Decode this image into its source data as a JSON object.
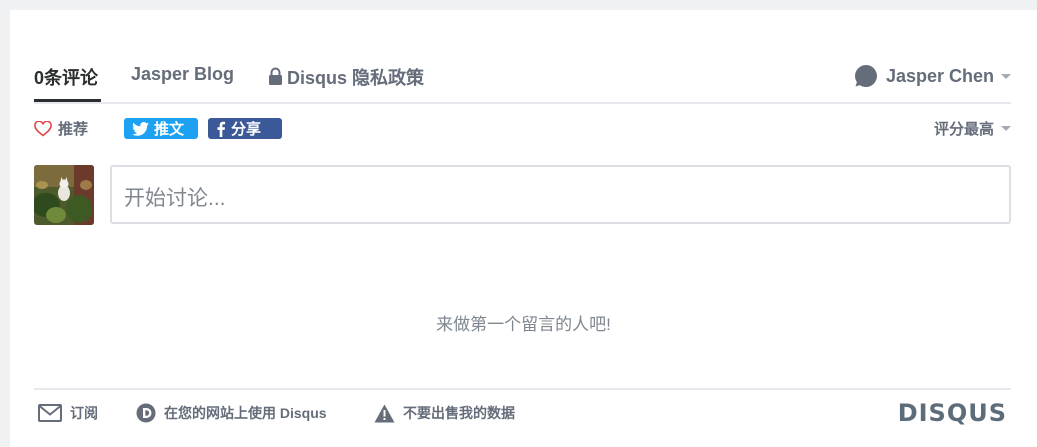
{
  "nav": {
    "tabs": [
      {
        "label": "0条评论",
        "active": true
      },
      {
        "label": "Jasper Blog",
        "active": false
      },
      {
        "label": "Disqus 隐私政策",
        "active": false
      }
    ],
    "user": {
      "name": "Jasper Chen",
      "icon": "speech-bubble-icon"
    }
  },
  "actions": {
    "recommend_label": "推荐",
    "tweet_label": "推文",
    "share_label": "分享",
    "sort_label": "评分最高"
  },
  "composer": {
    "placeholder": "开始讨论..."
  },
  "empty_state": {
    "message": "来做第一个留言的人吧!"
  },
  "footer": {
    "subscribe_label": "订阅",
    "use_disqus_label": "在您的网站上使用 Disqus",
    "do_not_sell_label": "不要出售我的数据",
    "logo_text": "DISQUS"
  },
  "colors": {
    "accent_twitter": "#1da1f2",
    "accent_facebook": "#3b5998",
    "text_primary": "#2a2e2e",
    "text_secondary": "#656c7a"
  }
}
